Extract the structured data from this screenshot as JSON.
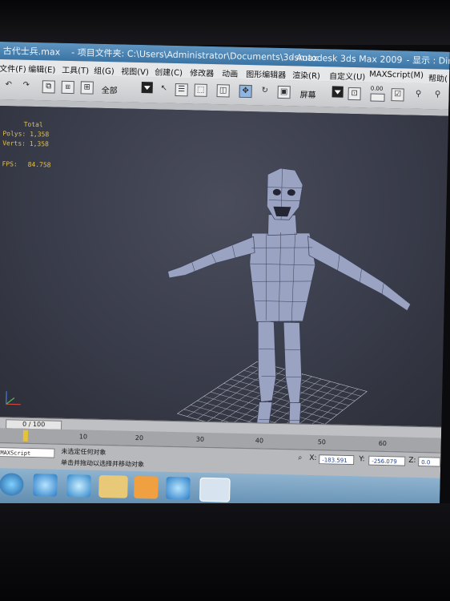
{
  "window": {
    "file_title": "古代士兵.max",
    "project_path": "- 项目文件夹: C:\\Users\\Administrator\\Documents\\3dsmax",
    "app_title": "- Autodesk 3ds Max  2009",
    "display_mode": "- 显示 : Dire"
  },
  "menu": {
    "items": [
      "文件(F)",
      "编辑(E)",
      "工具(T)",
      "组(G)",
      "视图(V)",
      "创建(C)",
      "修改器",
      "动画",
      "图形编辑器",
      "渲染(R)",
      "自定义(U)",
      "MAXScript(M)",
      "帮助("
    ]
  },
  "toolbar": {
    "selection_filter": "全部",
    "ref_coord": "屏幕",
    "snap_value": "0.00"
  },
  "viewport": {
    "stats": {
      "total_label": "Total",
      "polys_label": "Polys:",
      "polys_value": "1,358",
      "verts_label": "Verts:",
      "verts_value": "1,358",
      "fps_label": "FPS:",
      "fps_value": "84.758"
    },
    "axis_labels": {
      "x": "x",
      "y": "y",
      "z": "z"
    }
  },
  "timeline": {
    "frame_display": "0 / 100",
    "ticks": [
      "10",
      "20",
      "30",
      "40",
      "50",
      "60"
    ]
  },
  "status": {
    "maxscript_label": "MAXScript",
    "line1": "未选定任何对象",
    "line2": "单击并拖动以选择并移动对象",
    "x_label": "X:",
    "x_value": "-183.591",
    "y_label": "Y:",
    "y_value": "-256.079",
    "z_label": "Z:",
    "z_value": "0.0"
  },
  "taskbar": {
    "apps": [
      "start-orb-icon",
      "ie-icon",
      "explorer-icon",
      "media-player-icon",
      "ie-icon",
      "3dsmax-icon"
    ]
  },
  "colors": {
    "title_bar": "#4a80ae",
    "viewport_bg": "#3a3d4a",
    "stats_text": "#e3c24e",
    "model": "#9aa3c2",
    "grid": "#d8dae6",
    "key_marker": "#e7c234"
  }
}
